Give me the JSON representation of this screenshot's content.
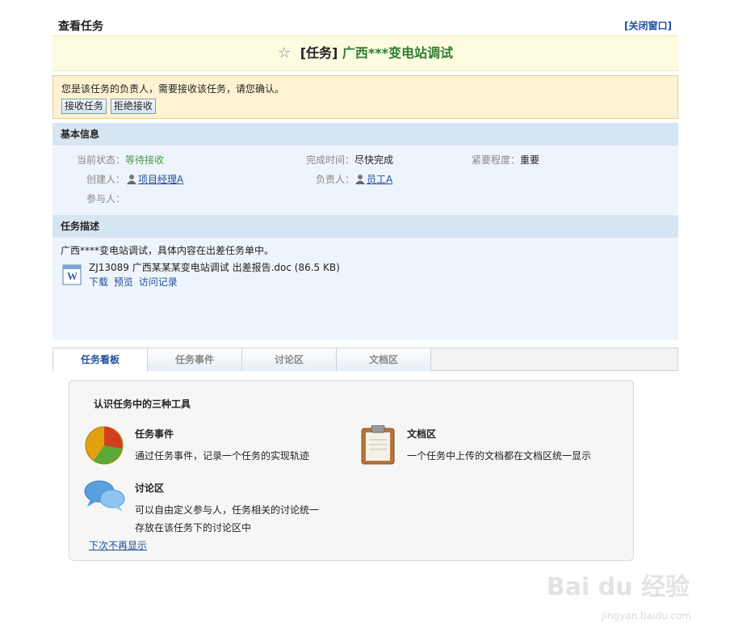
{
  "header": {
    "page_title": "查看任务",
    "close_link": "[关闭窗口]"
  },
  "task": {
    "star": "☆",
    "type_label": "[任务]",
    "name": "广西***变电站调试"
  },
  "notice": {
    "message": "您是该任务的负责人，需要接收该任务，请您确认。",
    "accept_button": "接收任务",
    "reject_button": "拒绝接收"
  },
  "basic_info": {
    "section_title": "基本信息",
    "status_label": "当前状态：",
    "status_value": "等待接收",
    "deadline_label": "完成时间：",
    "deadline_value": "尽快完成",
    "urgency_label": "紧要程度：",
    "urgency_value": "重要",
    "creator_label": "创建人：",
    "creator_value": "项目经理A",
    "owner_label": "负责人：",
    "owner_value": "员工A",
    "participants_label": "参与人："
  },
  "description": {
    "section_title": "任务描述",
    "text": "广西****变电站调试，具体内容在出差任务单中。",
    "attachment_name": "ZJ13089 广西某某某变电站调试 出差报告.doc (86.5 KB)",
    "download_link": "下载",
    "preview_link": "预览",
    "access_log_link": "访问记录"
  },
  "tabs": [
    {
      "label": "任务看板"
    },
    {
      "label": "任务事件"
    },
    {
      "label": "讨论区"
    },
    {
      "label": "文档区"
    }
  ],
  "board": {
    "title": "认识任务中的三种工具",
    "tools": [
      {
        "title": "任务事件",
        "desc": "通过任务事件，记录一个任务的实现轨迹",
        "icon": "pie-chart-icon"
      },
      {
        "title": "文档区",
        "desc": "一个任务中上传的文档都在文档区统一显示",
        "icon": "clipboard-icon"
      },
      {
        "title": "讨论区",
        "desc_line1": "可以自由定义参与人，任务相关的讨论统一",
        "desc_line2": "存放在该任务下的讨论区中",
        "icon": "chat-bubbles-icon"
      }
    ],
    "dont_show_link": "下次不再显示"
  },
  "watermark": {
    "brand": "Bai du 经验",
    "url": "jingyan.baidu.com"
  },
  "colors": {
    "accent_blue": "#1d4f9c",
    "task_green": "#2e7d32",
    "status_green": "#4a9a4a",
    "title_bg": "#fdfbe0",
    "notice_bg": "#fdf3d3",
    "panel_bg": "#eef4fb",
    "section_bg": "#d6e5f2"
  }
}
